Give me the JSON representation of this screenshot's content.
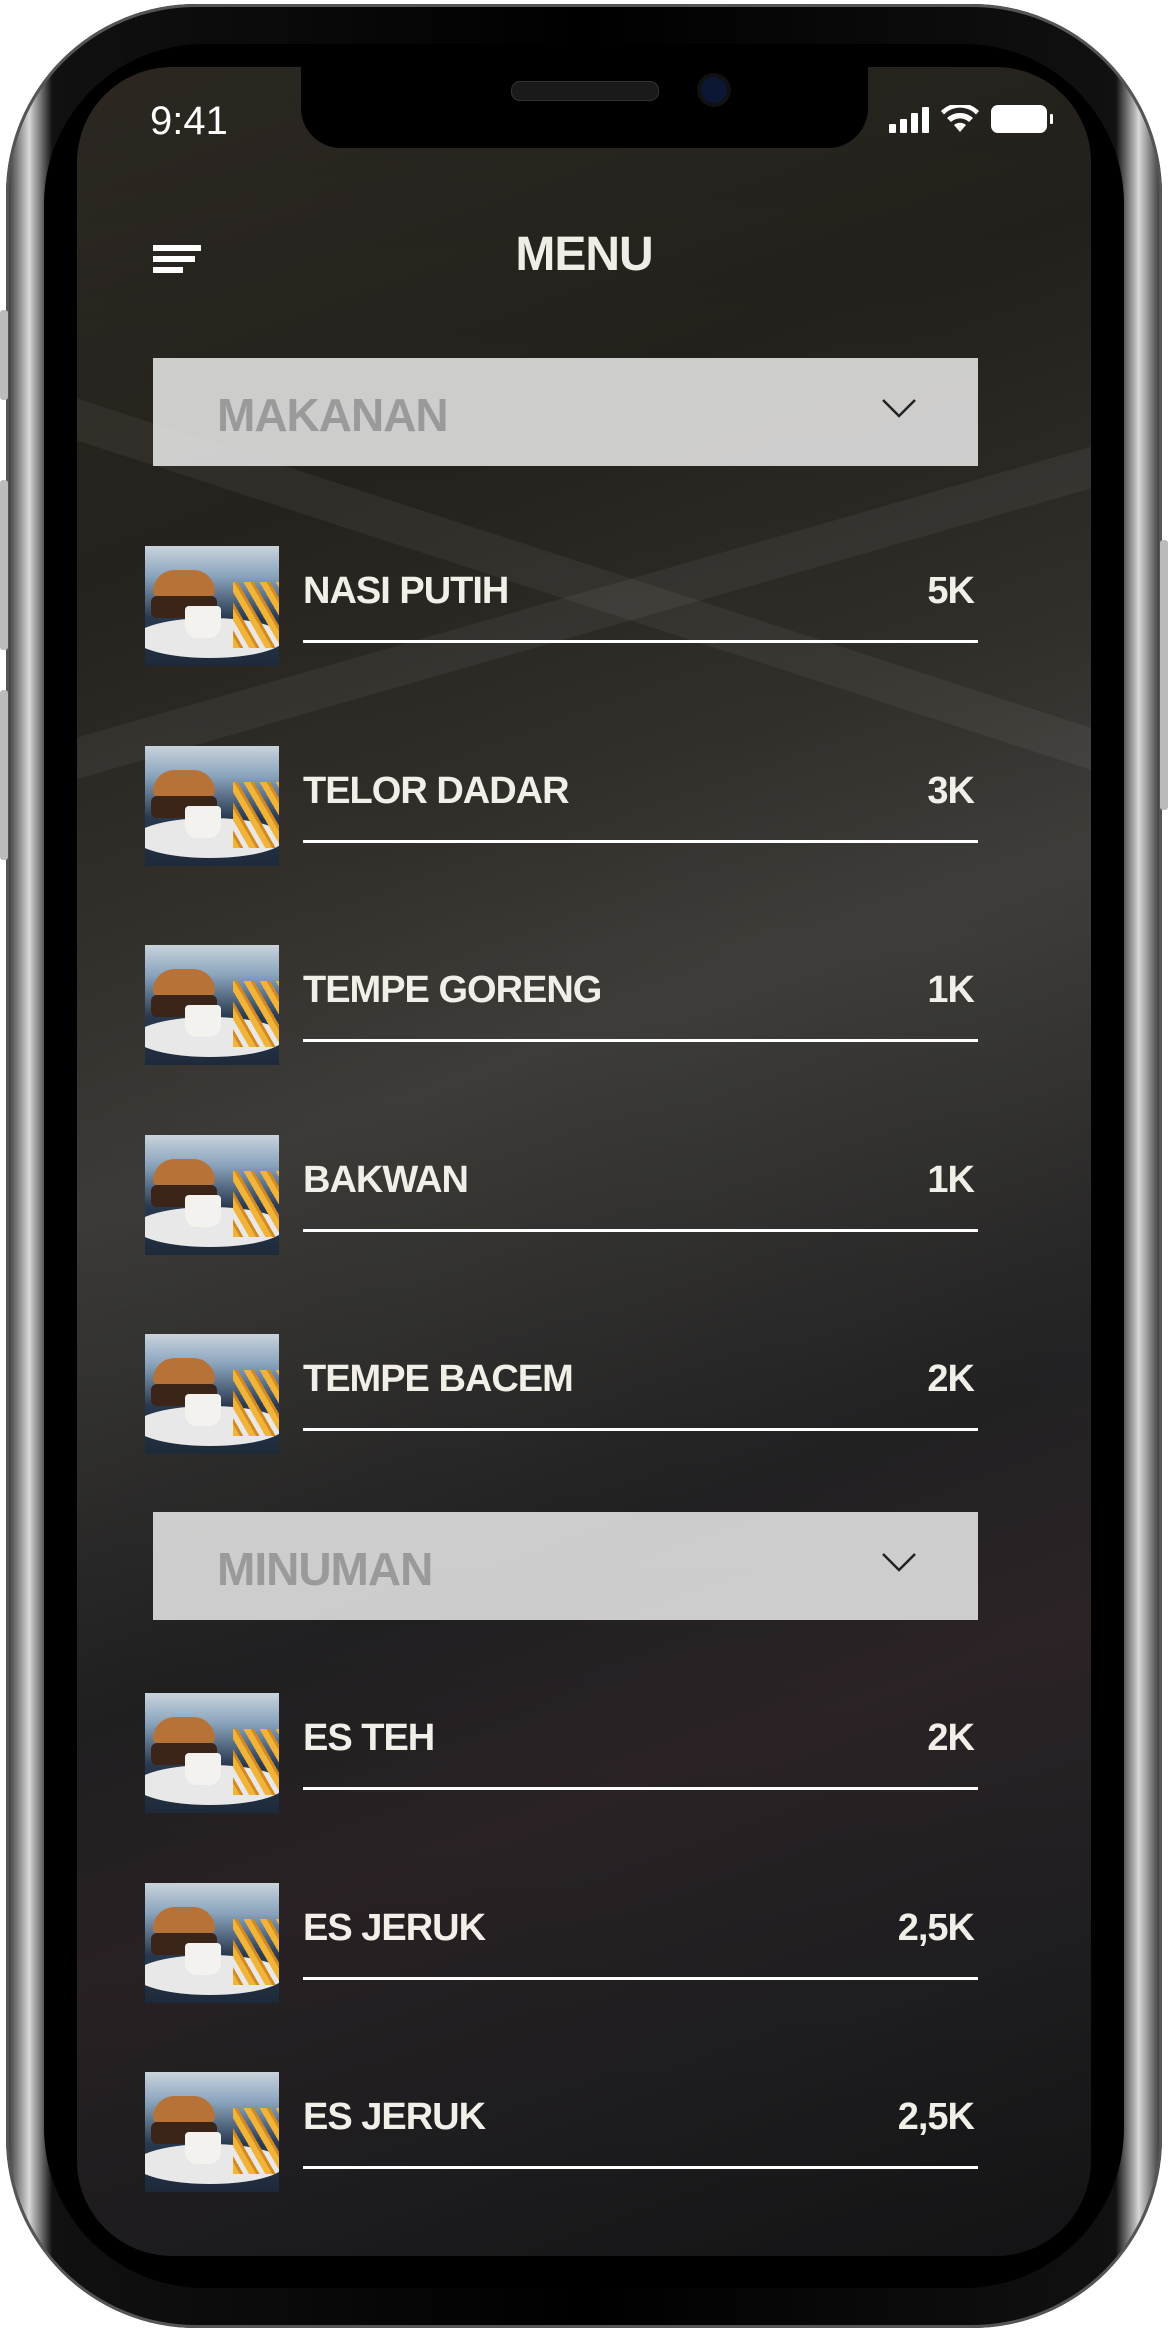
{
  "status_bar": {
    "time": "9:41"
  },
  "header": {
    "title": "MENU",
    "menu_icon": "hamburger-icon"
  },
  "sections": [
    {
      "label": "MAKANAN",
      "icon": "chevron-down-icon",
      "items": [
        {
          "name": "NASI PUTIH",
          "price": "5K"
        },
        {
          "name": "TELOR DADAR",
          "price": "3K"
        },
        {
          "name": "TEMPE GORENG",
          "price": "1K"
        },
        {
          "name": "BAKWAN",
          "price": "1K"
        },
        {
          "name": "TEMPE BACEM",
          "price": "2K"
        }
      ]
    },
    {
      "label": "MINUMAN",
      "icon": "chevron-down-icon",
      "items": [
        {
          "name": "ES TEH",
          "price": "2K"
        },
        {
          "name": "ES JERUK",
          "price": "2,5K"
        },
        {
          "name": "ES JERUK",
          "price": "2,5K"
        }
      ]
    }
  ]
}
